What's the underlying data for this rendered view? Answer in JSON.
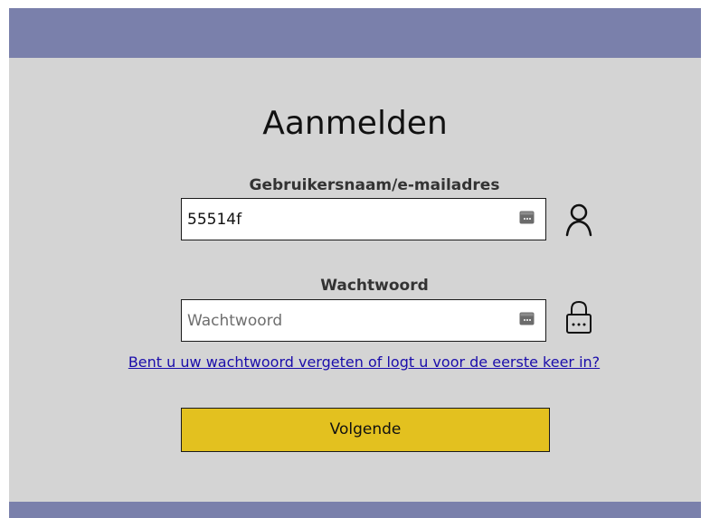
{
  "header": {
    "title": "Aanmelden"
  },
  "username": {
    "label": "Gebruikersnaam/e-mailadres",
    "value": "55514f",
    "placeholder": "",
    "side_icon": "user-icon",
    "field_icon": "password-manager-key-icon"
  },
  "password": {
    "label": "Wachtwoord",
    "value": "",
    "placeholder": "Wachtwoord",
    "side_icon": "lock-icon",
    "field_icon": "password-manager-key-icon"
  },
  "links": {
    "forgot": "Bent u uw wachtwoord vergeten of logt u voor de eerste keer in?"
  },
  "actions": {
    "next_label": "Volgende"
  },
  "colors": {
    "banner": "#7a80ab",
    "background": "#d4d4d4",
    "button": "#e3c11f",
    "link": "#1a0dab"
  }
}
